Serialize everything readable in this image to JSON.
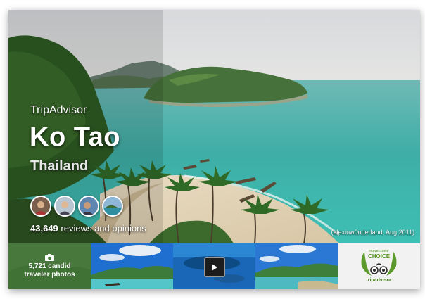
{
  "brand": "TripAdvisor",
  "destination": {
    "name": "Ko Tao",
    "country": "Thailand"
  },
  "reviews": {
    "count": "43,649",
    "label": "reviews and opinions"
  },
  "photo_credit": "(alexinw0nderland, Aug 2011)",
  "thumbnails": {
    "photos": {
      "count_line": "5,721 candid",
      "label_line": "traveler photos",
      "icon": "camera-icon"
    },
    "video": {
      "icon": "play-icon"
    },
    "award": {
      "top_line": "TRAVELLERS'",
      "choice_line": "CHOICE",
      "logo_text": "tripadvisor",
      "colors": {
        "green": "#5b9a2b"
      }
    }
  },
  "colors": {
    "sea": "#3fb0a8",
    "sky": "#d9dde0",
    "overlay_green": "#407034"
  }
}
